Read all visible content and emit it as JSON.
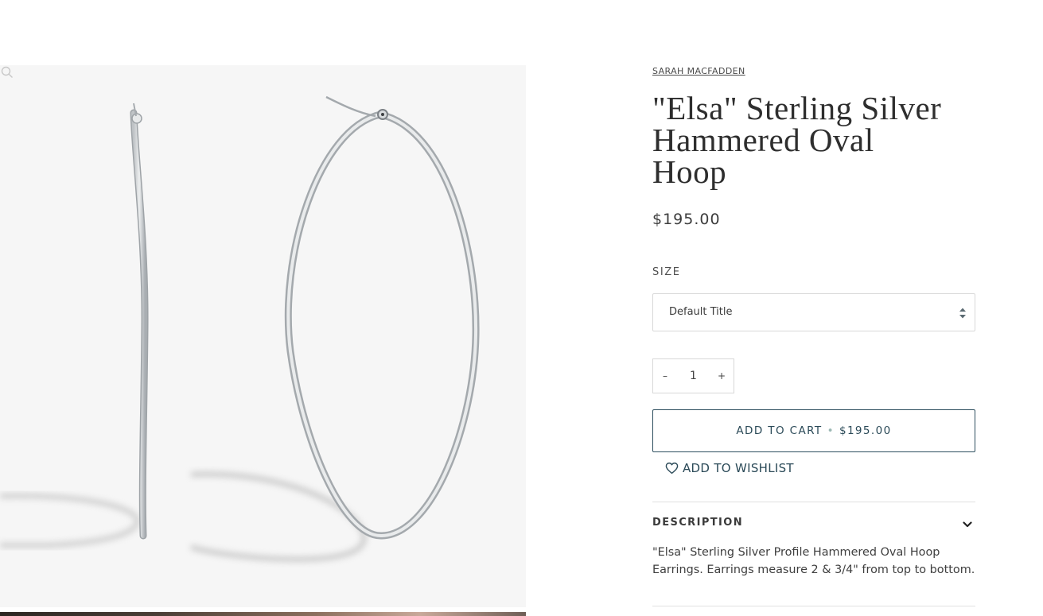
{
  "product": {
    "vendor": "SARAH MACFADDEN",
    "title_lines": [
      "\"Elsa\" Sterling Silver",
      "Hammered Oval",
      "Hoop"
    ],
    "price": "$195.00"
  },
  "options": {
    "size_label": "SIZE",
    "size_value": "Default Title"
  },
  "quantity": {
    "minus": "–",
    "value": "1",
    "plus": "+"
  },
  "cart": {
    "label": "ADD TO CART",
    "separator": "•",
    "price": "$195.00"
  },
  "wishlist": {
    "label": "ADD TO WISHLIST",
    "icon": "heart-icon"
  },
  "description": {
    "heading": "DESCRIPTION",
    "text_lines": [
      "\"Elsa\" Sterling Silver Profile Hammered Oval Hoop",
      "Earrings. Earrings measure 2 & 3/4\" from top to bottom."
    ]
  },
  "gallery": {
    "zoom_icon": "magnifier-icon"
  },
  "colors": {
    "accent": "#2b4a58",
    "border": "#d8d8d8",
    "image_bg": "#f6f6f6"
  }
}
